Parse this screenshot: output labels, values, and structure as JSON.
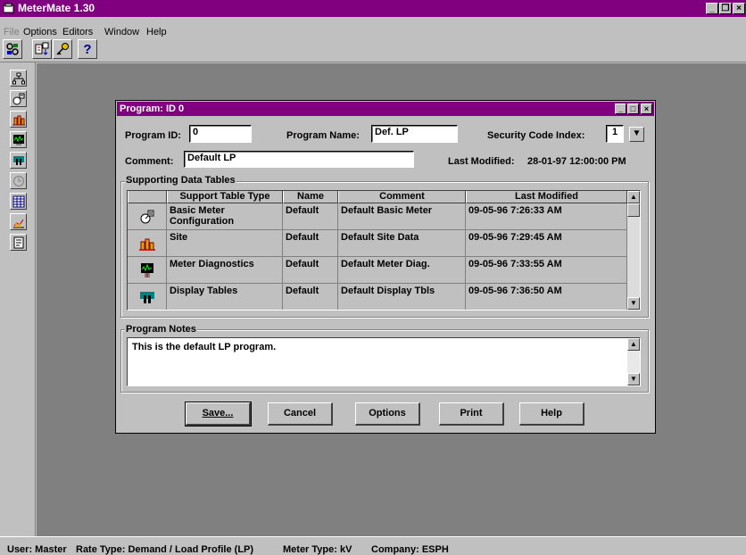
{
  "app": {
    "title": "MeterMate 1.30"
  },
  "menu": {
    "items": [
      "File",
      "Options",
      "Editors",
      "Window",
      "Help"
    ]
  },
  "toolbar": {
    "buttons": [
      "connect-icon",
      "config-icon",
      "key-icon",
      "help-icon"
    ],
    "help_glyph": "?"
  },
  "left_toolbar": {
    "buttons": [
      "network-icon",
      "meter-config-icon",
      "site-icon",
      "diagnostics-icon",
      "display-icon",
      "clock-icon",
      "table-icon",
      "load-profile-icon",
      "program-icon"
    ]
  },
  "dialog": {
    "title": "Program: ID 0",
    "program_id_label": "Program ID:",
    "program_id": "0",
    "program_name_label": "Program Name:",
    "program_name": "Def. LP",
    "security_label": "Security Code Index:",
    "security_value": "1",
    "comment_label": "Comment:",
    "comment": "Default LP",
    "last_modified_label": "Last Modified:",
    "last_modified": "28-01-97 12:00:00 PM",
    "tables_group": "Supporting Data Tables",
    "columns": [
      "Support Table Type",
      "Name",
      "Comment",
      "Last Modified"
    ],
    "rows": [
      {
        "icon": "meter-config-icon",
        "type": "Basic Meter Configuration",
        "name": "Default",
        "comment": "Default Basic Meter",
        "modified": "09-05-96 7:26:33 AM"
      },
      {
        "icon": "site-icon",
        "type": "Site",
        "name": "Default",
        "comment": "Default Site Data",
        "modified": "09-05-96 7:29:45 AM"
      },
      {
        "icon": "diagnostics-icon",
        "type": "Meter Diagnostics",
        "name": "Default",
        "comment": "Default Meter Diag.",
        "modified": "09-05-96 7:33:55 AM"
      },
      {
        "icon": "display-icon",
        "type": "Display Tables",
        "name": "Default",
        "comment": "Default Display Tbls",
        "modified": "09-05-96 7:36:50 AM"
      }
    ],
    "notes_group": "Program Notes",
    "notes": "This is the default LP program.",
    "buttons": [
      "Save...",
      "Cancel",
      "Options",
      "Print",
      "Help"
    ]
  },
  "status": {
    "user": "User: Master",
    "rate_type": "Rate Type: Demand / Load Profile (LP)",
    "meter_type": "Meter Type: kV",
    "company": "Company: ESPH"
  },
  "colors": {
    "title_bar": "#800080",
    "face": "#c0c0c0",
    "workspace": "#808080"
  }
}
